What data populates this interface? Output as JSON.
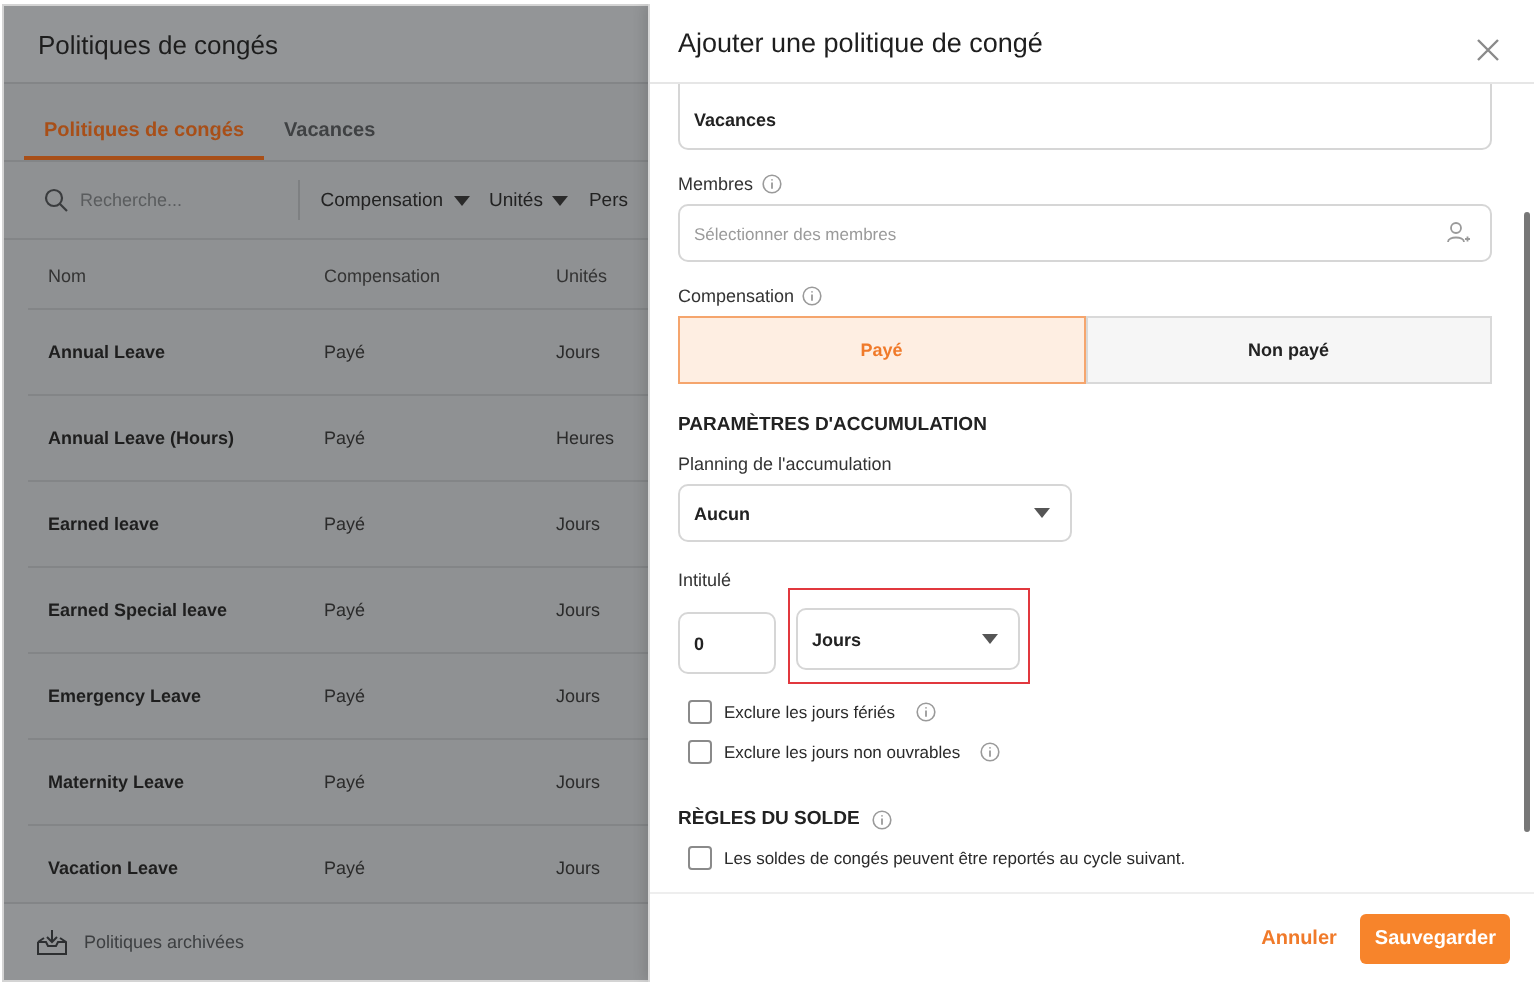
{
  "background_page": {
    "title": "Politiques de congés",
    "tabs": [
      {
        "label": "Politiques de congés",
        "selected": true
      },
      {
        "label": "Vacances",
        "selected": false
      }
    ],
    "search": {
      "placeholder": "Recherche..."
    },
    "filters": [
      {
        "label": "Compensation",
        "caret": true
      },
      {
        "label": "Unités",
        "caret": true
      },
      {
        "label": "Pers",
        "caret": false
      }
    ],
    "table": {
      "columns": [
        "Nom",
        "Compensation",
        "Unités"
      ],
      "rows": [
        [
          "Annual Leave",
          "Payé",
          "Jours"
        ],
        [
          "Annual Leave (Hours)",
          "Payé",
          "Heures"
        ],
        [
          "Earned leave",
          "Payé",
          "Jours"
        ],
        [
          "Earned Special leave",
          "Payé",
          "Jours"
        ],
        [
          "Emergency Leave",
          "Payé",
          "Jours"
        ],
        [
          "Maternity Leave",
          "Payé",
          "Jours"
        ],
        [
          "Vacation Leave",
          "Payé",
          "Jours"
        ]
      ]
    },
    "footer_link": "Politiques archivées"
  },
  "drawer": {
    "title": "Ajouter une politique de congé",
    "name_field": {
      "value": "Vacances"
    },
    "members": {
      "label": "Membres",
      "placeholder": "Sélectionner des membres"
    },
    "compensation": {
      "label": "Compensation",
      "options": [
        {
          "label": "Payé",
          "selected": true
        },
        {
          "label": "Non payé",
          "selected": false
        }
      ]
    },
    "accrual_heading": "PARAMÈTRES D'ACCUMULATION",
    "accrual_schedule": {
      "label": "Planning de l'accumulation",
      "value": "Aucun"
    },
    "entitlement": {
      "label": "Intitulé",
      "amount": "0",
      "unit": "Jours",
      "highlighted": true
    },
    "exclusions": [
      {
        "label": "Exclure les jours fériés",
        "checked": false
      },
      {
        "label": "Exclure les jours non ouvrables",
        "checked": false
      }
    ],
    "balance_heading": "RÈGLES DU SOLDE",
    "balance_rules": [
      {
        "label": "Les soldes de congés peuvent être reportés au cycle suivant.",
        "checked": false
      }
    ],
    "buttons": {
      "cancel": "Annuler",
      "save": "Sauvegarder"
    }
  }
}
